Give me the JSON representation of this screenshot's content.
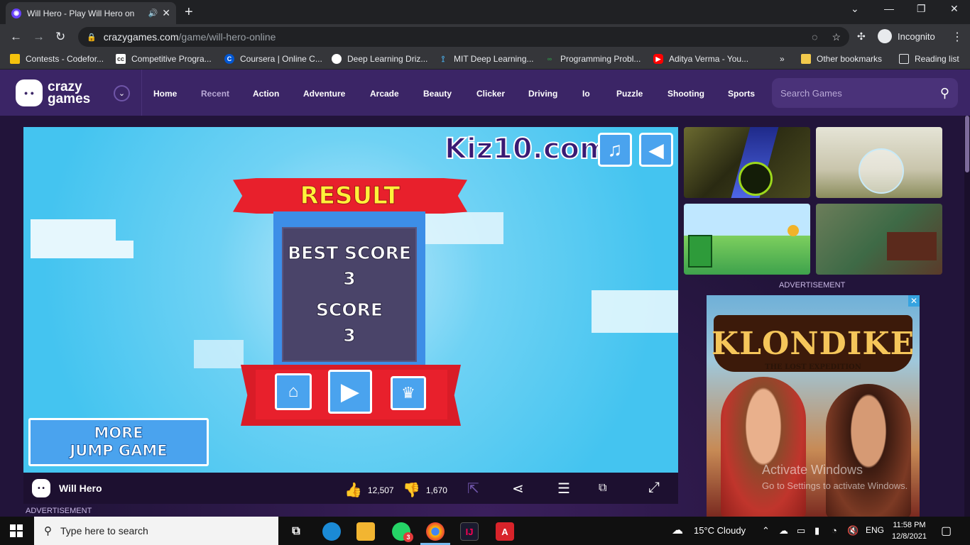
{
  "browser": {
    "tab_title": "Will Hero - Play Will Hero on",
    "url_host": "crazygames.com",
    "url_path": "/game/will-hero-online",
    "incognito_label": "Incognito"
  },
  "bookmarks": [
    {
      "label": "Contests - Codefor...",
      "icon": "codeforces-icon",
      "color": "#f4c20d"
    },
    {
      "label": "Competitive Progra...",
      "icon": "cc-icon",
      "color": "#ffffff"
    },
    {
      "label": "Coursera | Online C...",
      "icon": "coursera-icon",
      "color": "#0056d2"
    },
    {
      "label": "Deep Learning Driz...",
      "icon": "globe-icon",
      "color": "#ffffff"
    },
    {
      "label": "MIT Deep Learning...",
      "icon": "network-icon",
      "color": "#4aa8e0"
    },
    {
      "label": "Programming Probl...",
      "icon": "gfg-icon",
      "color": "#2f8d46"
    },
    {
      "label": "Aditya Verma - You...",
      "icon": "youtube-icon",
      "color": "#ff0000"
    }
  ],
  "bookmarks_other": "Other bookmarks",
  "bookmarks_reading": "Reading list",
  "site": {
    "logo_top": "crazy",
    "logo_bottom": "games",
    "nav": [
      "Home",
      "Recent",
      "Action",
      "Adventure",
      "Arcade",
      "Beauty",
      "Clicker",
      "Driving",
      "Io",
      "Puzzle",
      "Shooting",
      "Sports"
    ],
    "search_placeholder": "Search Games"
  },
  "game": {
    "brand": "Kiz10.com",
    "result_title": "RESULT",
    "best_score_label": "BEST SCORE",
    "best_score": "3",
    "score_label": "SCORE",
    "score": "3",
    "more_line1": "MORE",
    "more_line2": "JUMP GAME"
  },
  "gamebar": {
    "title": "Will Hero",
    "likes": "12,507",
    "dislikes": "1,670"
  },
  "advertisement_label": "ADVERTISEMENT",
  "ad": {
    "brand": "KLONDIKE",
    "subtitle": "THE LOST EXPEDITION"
  },
  "watermark": {
    "line1": "Activate Windows",
    "line2": "Go to Settings to activate Windows."
  },
  "taskbar": {
    "search_placeholder": "Type here to search",
    "weather": "15°C  Cloudy",
    "language": "ENG",
    "time": "11:58 PM",
    "date": "12/8/2021",
    "whatsapp_badge": "3"
  },
  "colors": {
    "site_header": "#3b2566",
    "sky": "#44c4f0",
    "ribbon": "#e8202c",
    "button_blue": "#4aa3ee"
  }
}
